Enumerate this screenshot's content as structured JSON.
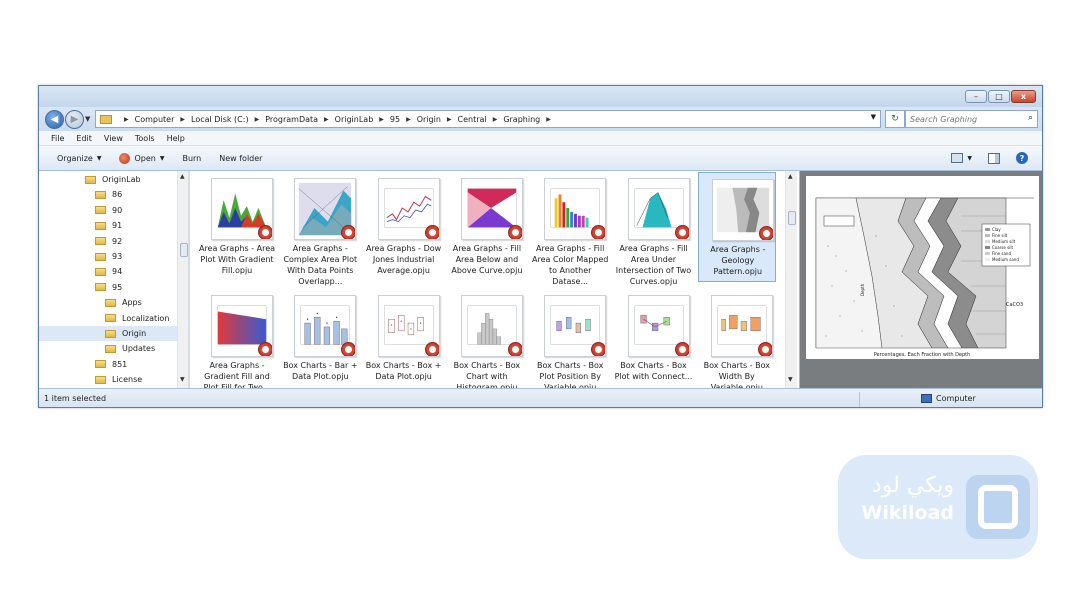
{
  "window": {
    "controls": {
      "minimize": "–",
      "maximize": "□",
      "close": "x"
    }
  },
  "address": {
    "crumbs": [
      "Computer",
      "Local Disk (C:)",
      "ProgramData",
      "OriginLab",
      "95",
      "Origin",
      "Central",
      "Graphing"
    ],
    "search_placeholder": "Search Graphing"
  },
  "menu": {
    "items": [
      "File",
      "Edit",
      "View",
      "Tools",
      "Help"
    ]
  },
  "toolbar": {
    "organize": "Organize",
    "open": "Open",
    "burn": "Burn",
    "new_folder": "New folder"
  },
  "nav": {
    "items": [
      {
        "label": "OriginLab",
        "level": 0
      },
      {
        "label": "86",
        "level": 1
      },
      {
        "label": "90",
        "level": 1
      },
      {
        "label": "91",
        "level": 1
      },
      {
        "label": "92",
        "level": 1
      },
      {
        "label": "93",
        "level": 1
      },
      {
        "label": "94",
        "level": 1
      },
      {
        "label": "95",
        "level": 1
      },
      {
        "label": "Apps",
        "level": 2
      },
      {
        "label": "Localization",
        "level": 2
      },
      {
        "label": "Origin",
        "level": 2,
        "selected": true
      },
      {
        "label": "Updates",
        "level": 2
      },
      {
        "label": "851",
        "level": 1
      },
      {
        "label": "License",
        "level": 1
      }
    ]
  },
  "files": [
    {
      "label": "Area Graphs - Area Plot With Gradient Fill.opju",
      "thumb": "area-gradient"
    },
    {
      "label": "Area Graphs - Complex Area Plot With Data Points Overlapp...",
      "thumb": "complex-area"
    },
    {
      "label": "Area Graphs - Dow Jones Industrial Average.opju",
      "thumb": "dow-jones"
    },
    {
      "label": "Area Graphs - Fill Area Below and Above Curve.opju",
      "thumb": "fill-below-above"
    },
    {
      "label": "Area Graphs - Fill Area Color Mapped to Another Datase...",
      "thumb": "color-mapped"
    },
    {
      "label": "Area Graphs - Fill Area Under Intersection of Two Curves.opju",
      "thumb": "intersection"
    },
    {
      "label": "Area Graphs - Geology Pattern.opju",
      "thumb": "geology",
      "selected": true
    },
    {
      "label": "Area Graphs - Gradient Fill and Plot Fill for Two...",
      "thumb": "gradient-two"
    },
    {
      "label": "Box Charts - Bar + Data Plot.opju",
      "thumb": "box-bar"
    },
    {
      "label": "Box Charts - Box + Data Plot.opju",
      "thumb": "box-data"
    },
    {
      "label": "Box Charts - Box Chart with Histogram.opju",
      "thumb": "box-hist"
    },
    {
      "label": "Box Charts - Box Plot Position By Variable.opju",
      "thumb": "box-position"
    },
    {
      "label": "Box Charts - Box Plot with Connect...",
      "thumb": "box-connect"
    },
    {
      "label": "Box Charts - Box Width By Variable.opju",
      "thumb": "box-width"
    }
  ],
  "preview": {
    "label_percentages": "Percentages, Each Fraction with Depth",
    "label_caco3": "CaCO3",
    "label_depth": "Depth",
    "legend": [
      "Clay",
      "Fine silt",
      "Medium silt",
      "Coarse silt",
      "Fine sand",
      "Medium sand"
    ]
  },
  "status": {
    "left": "1 item selected",
    "right": "Computer"
  },
  "watermark": {
    "arabic": "ويكي لود",
    "english": "Wikiload"
  }
}
